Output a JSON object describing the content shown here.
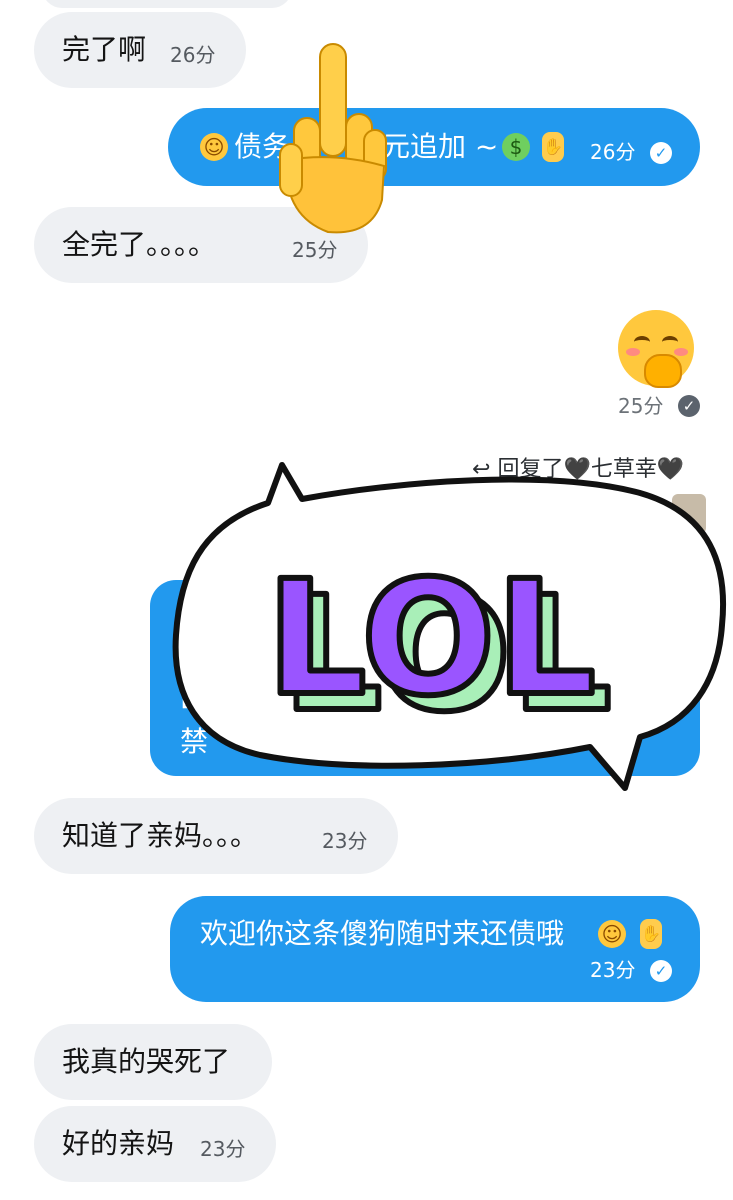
{
  "chat": {
    "messages": [
      {
        "text": "完了啊",
        "time": "26分"
      },
      {
        "text": "☺️债务 … 元追加 ~ 🤑 🖕",
        "text_visible_left": "债务",
        "text_visible_right": "元追加 ~",
        "time": "26分"
      },
      {
        "text": "全完了。。。。",
        "time": "25分"
      },
      {
        "time": "25分"
      },
      {
        "reply_label": "回复了🖤七草幸🖤"
      },
      {
        "fragments": [
          "B",
          "禁"
        ]
      },
      {
        "text": "知道了亲妈。。。",
        "time": "23分"
      },
      {
        "text": "欢迎你这条傻狗随时来还债哦☺️🖕",
        "text_plain": "欢迎你这条傻狗随时来还债哦",
        "time": "23分"
      },
      {
        "text": "我真的哭死了"
      },
      {
        "text": "好的亲妈",
        "time": "23分"
      }
    ],
    "sticker_lol": {
      "label": "LOL"
    }
  },
  "colors": {
    "outgoing_bubble": "#2299ee",
    "incoming_bubble": "#eef0f3",
    "lol_fill": "#9a55ff",
    "lol_shadow": "#a9efb8"
  },
  "icons": {
    "check": "check-circle-icon",
    "reply": "reply-arrow-icon",
    "finger": "middle-finger-emoji",
    "smile": "smiling-face-emoji",
    "money": "money-mouth-emoji",
    "giggle": "hand-over-mouth-emoji"
  }
}
